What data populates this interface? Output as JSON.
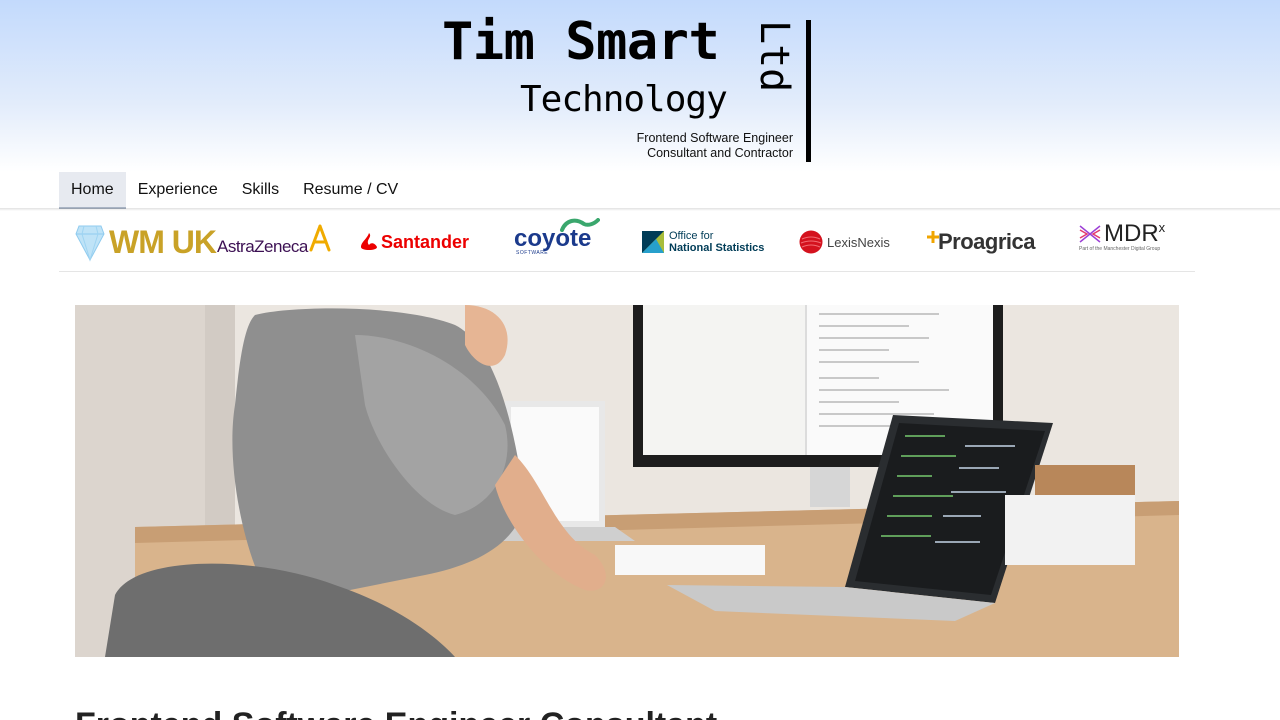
{
  "brand": {
    "title": "Tim Smart",
    "subtitle": "Technology",
    "suffix": "Ltd",
    "tagline_line1": "Frontend Software Engineer",
    "tagline_line2": "Consultant and Contractor"
  },
  "nav": {
    "items": [
      {
        "label": "Home",
        "active": true
      },
      {
        "label": "Experience",
        "active": false
      },
      {
        "label": "Skills",
        "active": false
      },
      {
        "label": "Resume / CV",
        "active": false
      }
    ]
  },
  "clients": [
    {
      "name": "WM UK",
      "icon": "diamond-icon",
      "color": "#c9a227"
    },
    {
      "name": "AstraZeneca",
      "icon": "astrazeneca-mark-icon",
      "color": "#3c1053"
    },
    {
      "name": "Santander",
      "icon": "flame-icon",
      "color": "#ec0000"
    },
    {
      "name": "coyote",
      "sub": "SOFTWARE",
      "icon": "coyote-swoosh-icon",
      "color": "#1b3a8c"
    },
    {
      "name_line1": "Office for",
      "name_line2": "National Statistics",
      "icon": "ons-icon",
      "color": "#003c57"
    },
    {
      "name": "LexisNexis",
      "icon": "lexisnexis-ball-icon",
      "color": "#d4121e"
    },
    {
      "name": "Proagrica",
      "icon": "plus-icon",
      "color": "#333333"
    },
    {
      "name": "MDR",
      "sup": "x",
      "sub": "Part of the Manchester Digital Group",
      "icon": "mdr-lines-icon",
      "color": "#222222"
    }
  ],
  "hero": {
    "image": "person-working-at-desk-with-laptops-and-monitor"
  },
  "content": {
    "heading": "Frontend Software Engineer Consultant"
  },
  "colors": {
    "header_gradient_top": "#c3dafc",
    "nav_active_bg": "#e7eaf0"
  }
}
